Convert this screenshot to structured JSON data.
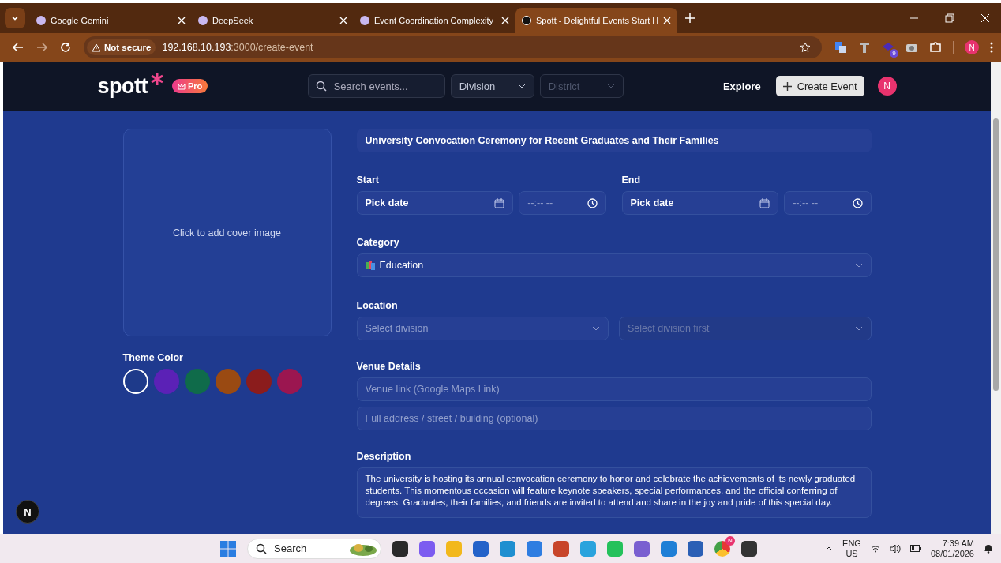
{
  "browser": {
    "tabs": [
      {
        "title": "Google Gemini",
        "selected": false
      },
      {
        "title": "DeepSeek",
        "selected": false
      },
      {
        "title": "Event Coordination Complexity",
        "selected": false
      },
      {
        "title": "Spott - Delightful Events Start H",
        "selected": true
      }
    ],
    "security": "Not secure",
    "host": "192.168.10.193",
    "path": ":3000/create-event",
    "extension_badge": "9",
    "profile": "N"
  },
  "header": {
    "logo": "spott",
    "pro": "Pro",
    "search": {
      "placeholder": "Search events..."
    },
    "division": {
      "label": "Division",
      "disabled": false
    },
    "district": {
      "label": "District",
      "disabled": true
    },
    "explore": "Explore",
    "create": "Create Event",
    "avatar": "N"
  },
  "cover": {
    "text": "Click to add cover image"
  },
  "theme": {
    "label": "Theme Color",
    "colors": [
      {
        "color": "#1e3a8a",
        "selected": true
      },
      {
        "color": "#5b21b6",
        "selected": false
      },
      {
        "color": "#0f6b4a",
        "selected": false
      },
      {
        "color": "#9a4a12",
        "selected": false
      },
      {
        "color": "#8b1c1c",
        "selected": false
      },
      {
        "color": "#9b1650",
        "selected": false
      }
    ]
  },
  "form": {
    "title": "University Convocation Ceremony for Recent Graduates and Their Families",
    "start": {
      "label": "Start",
      "date": "Pick date",
      "time": "--:-- --"
    },
    "end": {
      "label": "End",
      "date": "Pick date",
      "time": "--:-- --"
    },
    "category": {
      "label": "Category",
      "value": "Education"
    },
    "location": {
      "label": "Location",
      "division": {
        "placeholder": "Select division",
        "disabled": false
      },
      "district": {
        "placeholder": "Select division first",
        "disabled": true
      }
    },
    "venue": {
      "label": "Venue Details",
      "link": {
        "placeholder": "Venue link (Google Maps Link)"
      },
      "address": {
        "placeholder": "Full address / street / building (optional)"
      }
    },
    "description": {
      "label": "Description",
      "value": "The university is hosting its annual convocation ceremony to honor and celebrate the achievements of its newly graduated students. This momentous occasion will feature keynote speakers, special performances, and the official conferring of degrees. Graduates, their families, and friends are invited to attend and share in the joy and pride of this special day."
    }
  },
  "dev_badge": "N",
  "taskbar": {
    "search": "Search",
    "chrome_badge": "N",
    "lang": "ENG",
    "region": "US",
    "time": "7:39 AM",
    "date": "08/01/2026"
  }
}
